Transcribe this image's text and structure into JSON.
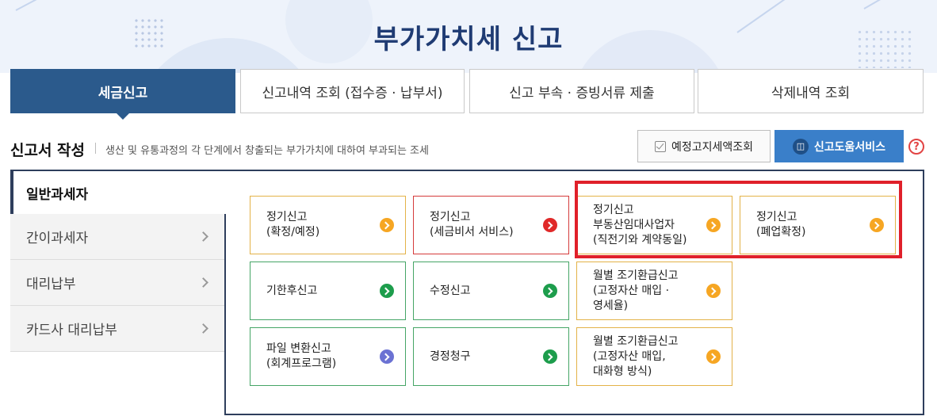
{
  "page": {
    "title": "부가가치세  신고"
  },
  "tabs": [
    {
      "label": "세금신고",
      "active": true
    },
    {
      "label": "신고내역 조회 (접수증 · 납부서)",
      "active": false
    },
    {
      "label": "신고 부속 · 증빙서류 제출",
      "active": false
    },
    {
      "label": "삭제내역 조회",
      "active": false
    }
  ],
  "section": {
    "title": "신고서 작성",
    "description": "생산 및 유통과정의 각 단계에서 창출되는 부가가치에 대하여 부과되는 조세"
  },
  "actions": {
    "notice_label": "예정고지세액조회",
    "help_label": "신고도움서비스",
    "question_symbol": "?"
  },
  "sidebar": {
    "items": [
      {
        "label": "일반과세자",
        "active": true
      },
      {
        "label": "간이과세자",
        "active": false
      },
      {
        "label": "대리납부",
        "active": false
      },
      {
        "label": "카드사 대리납부",
        "active": false
      }
    ]
  },
  "cards": [
    {
      "label": "정기신고\n(확정/예정)",
      "color": "yellow",
      "arrow": "orange"
    },
    {
      "label": "정기신고\n(세금비서 서비스)",
      "color": "red",
      "arrow": "red"
    },
    {
      "label": "정기신고\n부동산임대사업자\n(직전기와 계약동일)",
      "color": "yellow",
      "arrow": "orange"
    },
    {
      "label": "정기신고\n(폐업확정)",
      "color": "yellow",
      "arrow": "orange"
    },
    {
      "label": "기한후신고",
      "color": "green",
      "arrow": "green"
    },
    {
      "label": "수정신고",
      "color": "green",
      "arrow": "green"
    },
    {
      "label": "월별 조기환급신고\n(고정자산 매입 ·\n영세율)",
      "color": "yellow",
      "arrow": "orange"
    },
    {
      "label": "파일 변환신고\n(회계프로그램)",
      "color": "green",
      "arrow": "purple"
    },
    {
      "label": "경정청구",
      "color": "green",
      "arrow": "green"
    },
    {
      "label": "월별 조기환급신고\n(고정자산 매입,\n대화형 방식)",
      "color": "yellow",
      "arrow": "orange"
    }
  ],
  "colors": {
    "brand_navy": "#2b5a8c",
    "help_blue": "#3a7fc9",
    "highlight_red": "#e0202a",
    "card_yellow": "#e3b248",
    "card_green": "#45a566",
    "card_red": "#d53b3b"
  }
}
